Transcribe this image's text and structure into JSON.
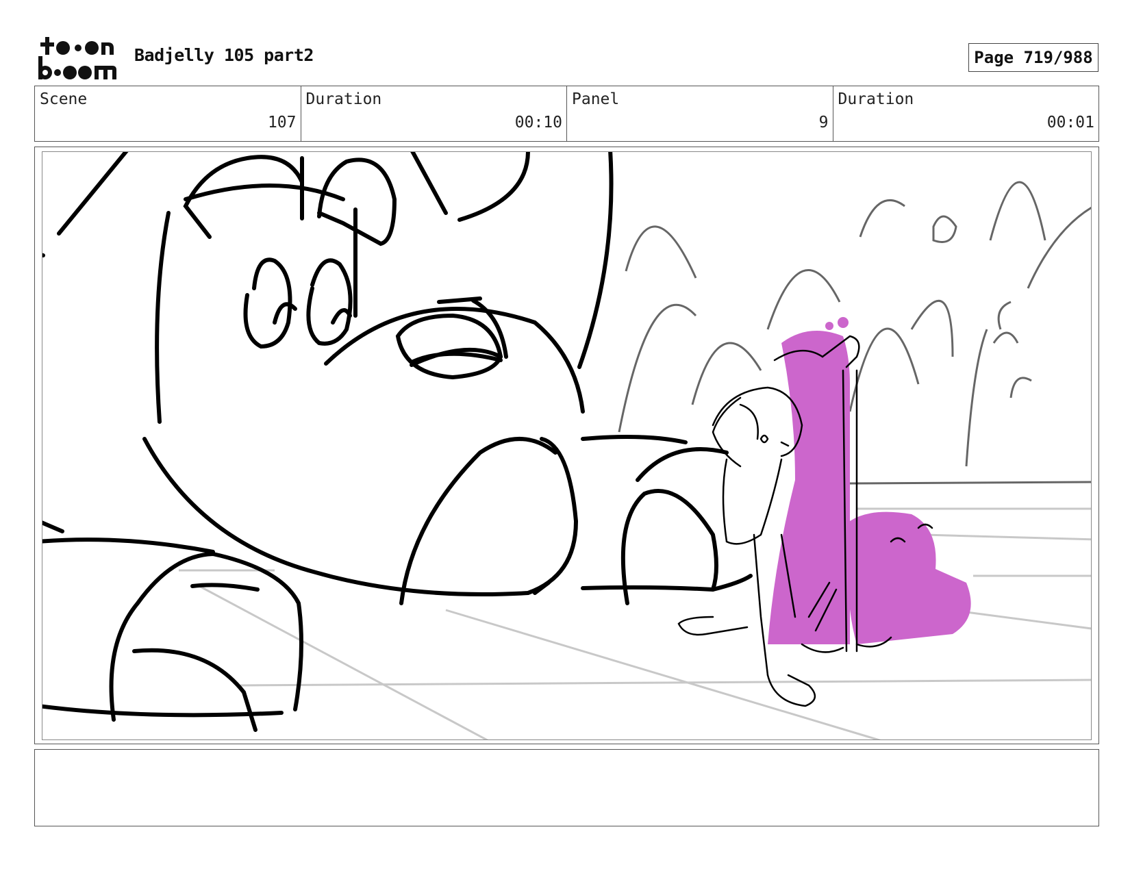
{
  "header": {
    "title": "Badjelly 105 part2",
    "page_label": "Page 719/988"
  },
  "info": {
    "scene_label": "Scene",
    "scene_value": "107",
    "duration_label": "Duration",
    "duration_value": "00:10",
    "panel_label": "Panel",
    "panel_value": "9",
    "panel_duration_label": "Duration",
    "panel_duration_value": "00:01"
  },
  "icons": {
    "logo": "toon-boom-logo-icon"
  },
  "colors": {
    "sketch_line": "#000000",
    "background_line": "#666666",
    "floor_line": "#c8c8c8",
    "magenta_fill": "#cc66cc"
  },
  "notes": {
    "text": ""
  }
}
